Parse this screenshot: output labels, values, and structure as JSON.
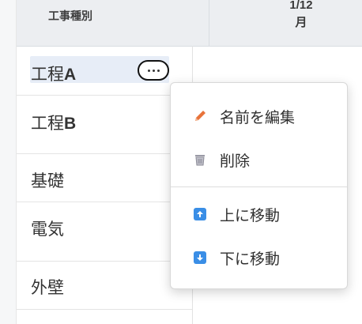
{
  "header": {
    "column_label": "工事種別",
    "date_line1": "1/12",
    "date_line2": "月"
  },
  "rows": [
    {
      "prefix": "工程",
      "suffix": "A"
    },
    {
      "prefix": "工程",
      "suffix": "B"
    },
    {
      "prefix": "基礎",
      "suffix": ""
    },
    {
      "prefix": "電気",
      "suffix": ""
    },
    {
      "prefix": "外壁",
      "suffix": ""
    }
  ],
  "context_menu": {
    "items": [
      {
        "label": "名前を編集",
        "icon": "pencil-icon"
      },
      {
        "label": "削除",
        "icon": "trash-icon"
      },
      {
        "label": "上に移動",
        "icon": "arrow-up-icon"
      },
      {
        "label": "下に移動",
        "icon": "arrow-down-icon"
      }
    ]
  },
  "colors": {
    "accent": "#3a8ee6",
    "pencil": "#e8733a",
    "highlight": "#e7edf7"
  }
}
